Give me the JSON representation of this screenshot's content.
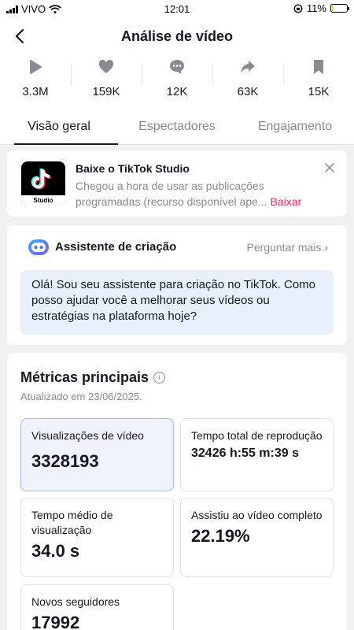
{
  "status_bar": {
    "carrier": "VIVO",
    "time": "12:01",
    "battery": "11%",
    "battery_level": 0.11
  },
  "header": {
    "title": "Análise de vídeo",
    "back_icon": "chevron-left-icon"
  },
  "stats": [
    {
      "icon": "play-icon",
      "value": "3.3M"
    },
    {
      "icon": "heart-icon",
      "value": "159K"
    },
    {
      "icon": "comment-icon",
      "value": "12K"
    },
    {
      "icon": "share-icon",
      "value": "63K"
    },
    {
      "icon": "bookmark-icon",
      "value": "15K"
    }
  ],
  "tabs": [
    {
      "label": "Visão geral",
      "active": true
    },
    {
      "label": "Espectadores",
      "active": false
    },
    {
      "label": "Engajamento",
      "active": false
    }
  ],
  "studio_banner": {
    "title": "Baixe o TikTok Studio",
    "description": "Chegou a hora de usar as publicações programadas (recurso disponível ape...",
    "link": "Baixar",
    "app_label": "Studio"
  },
  "assistant": {
    "title": "Assistente de criação",
    "more": "Perguntar mais",
    "message": "Olá! Sou seu assistente para criação no TikTok. Como posso ajudar você a melhorar seus vídeos ou estratégias na plataforma hoje?"
  },
  "metrics": {
    "title": "Métricas principais",
    "updated": "Atualizado em 23/06/2025.",
    "items": [
      {
        "label": "Visualizações de vídeo",
        "value": "3328193"
      },
      {
        "label": "Tempo total de reprodução",
        "value": "32426 h:55 m:39 s"
      },
      {
        "label": "Tempo médio de visualização",
        "value": "34.0 s"
      },
      {
        "label": "Assistiu ao vídeo completo",
        "value": "22.19%"
      },
      {
        "label": "Novos seguidores",
        "value": "17992"
      }
    ]
  },
  "colors": {
    "accent": "#fe2c55",
    "highlight_bg": "#eef3fc",
    "bubble_bg": "#eaf0fb",
    "muted": "#8a8b91"
  }
}
